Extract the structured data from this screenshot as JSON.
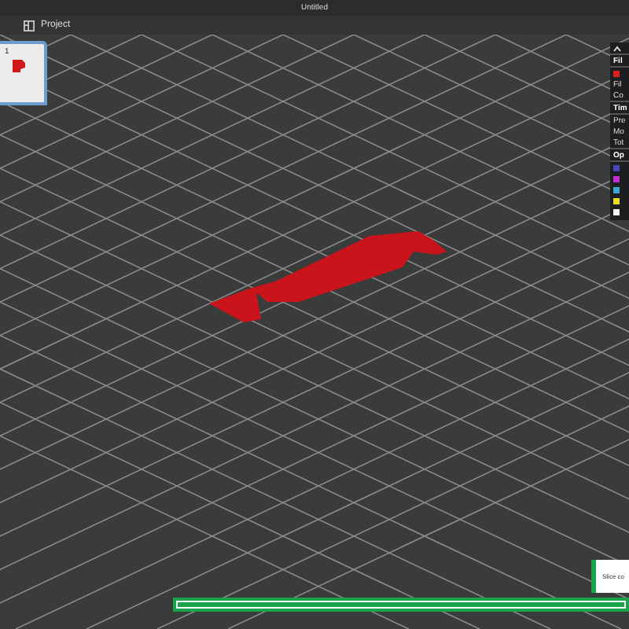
{
  "window": {
    "title": "Untitled"
  },
  "toolbar": {
    "project_label": "Project"
  },
  "plate": {
    "number": "1",
    "selected": true
  },
  "side_panel": {
    "items": [
      {
        "kind": "collapse"
      },
      {
        "kind": "header",
        "text": "Fil"
      },
      {
        "kind": "swatch",
        "color": "#e02020"
      },
      {
        "kind": "text",
        "text": "Fil"
      },
      {
        "kind": "text",
        "text": "Co"
      },
      {
        "kind": "header",
        "text": "Tim"
      },
      {
        "kind": "text",
        "text": "Pre"
      },
      {
        "kind": "text",
        "text": "Mo"
      },
      {
        "kind": "text",
        "text": "Tot"
      },
      {
        "kind": "header",
        "text": "Op"
      },
      {
        "kind": "swatch",
        "color": "#4848b8"
      },
      {
        "kind": "swatch",
        "color": "#c030d0"
      },
      {
        "kind": "swatch",
        "color": "#40a8d8"
      },
      {
        "kind": "swatch",
        "color": "#e8e020"
      },
      {
        "kind": "swatch",
        "color": "#f0f0f0"
      }
    ]
  },
  "notification": {
    "text": "Slice co"
  },
  "progress": {
    "level": 1
  }
}
